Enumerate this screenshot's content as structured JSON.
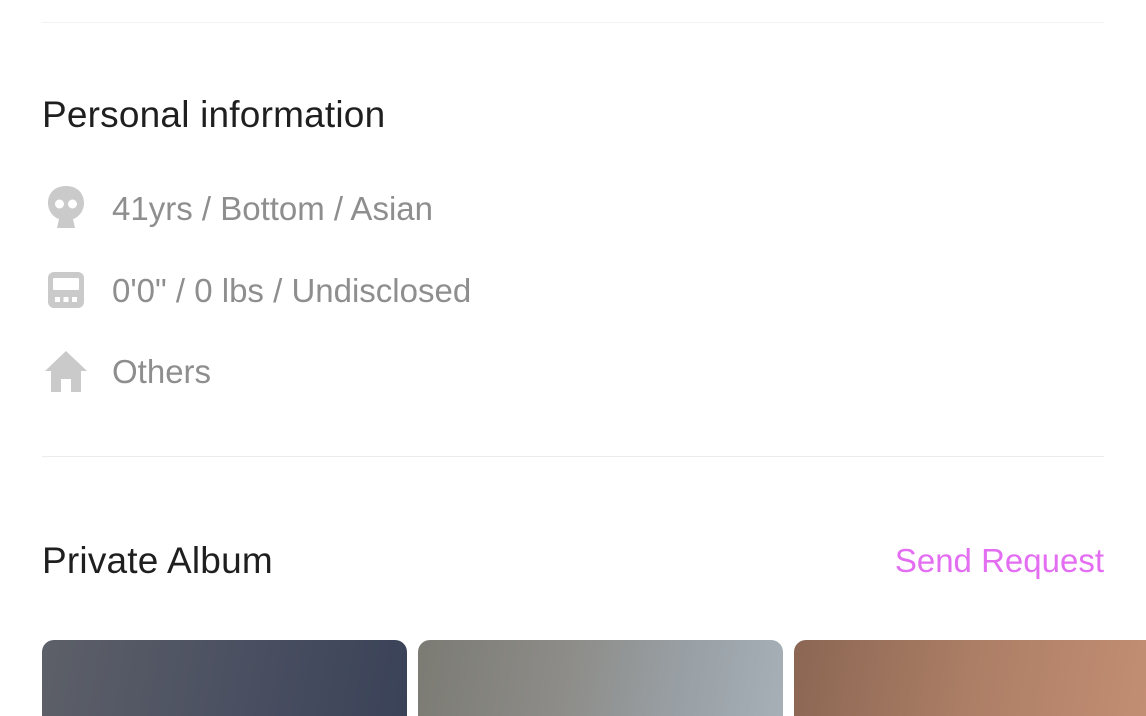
{
  "personal_info": {
    "title": "Personal information",
    "rows": [
      {
        "icon": "person-head-icon",
        "text": "41yrs / Bottom / Asian"
      },
      {
        "icon": "body-stats-icon",
        "text": "0'0\" / 0 lbs / Undisclosed"
      },
      {
        "icon": "home-icon",
        "text": "Others"
      }
    ]
  },
  "private_album": {
    "title": "Private Album",
    "send_request_label": "Send Request",
    "photo_count_visible": 3
  },
  "colors": {
    "accent": "#e36ef2",
    "title_text": "#1f1f1f",
    "secondary_text": "#8e8e8e",
    "icon_gray": "#c9c9c9",
    "divider": "#ececec"
  }
}
